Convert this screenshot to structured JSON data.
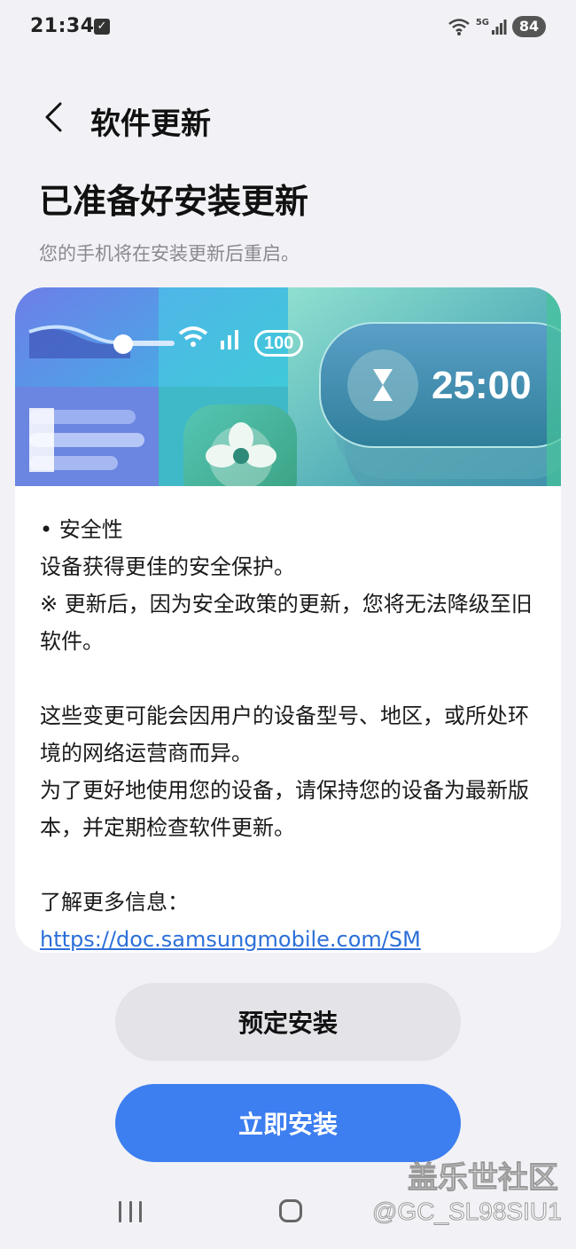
{
  "status_bar": {
    "time": "21:34",
    "notification_icon": "checkbox-icon",
    "network": "5G",
    "battery": "84"
  },
  "header": {
    "title": "软件更新"
  },
  "main": {
    "title": "已准备好安装更新",
    "subtitle": "您的手机将在安装更新后重启。"
  },
  "banner": {
    "timer": "25:00",
    "badge": "100"
  },
  "content": {
    "section_title": "• 安全性",
    "section_desc": "设备获得更佳的安全保护。",
    "warning": "※ 更新后，因为安全政策的更新，您将无法降级至旧软件。",
    "notice_1": "这些变更可能会因用户的设备型号、地区，或所处环境的网络运营商而异。",
    "notice_2": "为了更好地使用您的设备，请保持您的设备为最新版本，并定期检查软件更新。",
    "more_info_label": "了解更多信息：",
    "more_info_link": "https://doc.samsungmobile.com/SM"
  },
  "actions": {
    "schedule_label": "预定安装",
    "install_now_label": "立即安装"
  },
  "watermark": {
    "line1": "盖乐世社区",
    "line2": "@GC_SL98SIU1"
  },
  "colors": {
    "accent": "#3d7ef0",
    "link": "#2c6fd8",
    "background": "#f2f2f6"
  }
}
